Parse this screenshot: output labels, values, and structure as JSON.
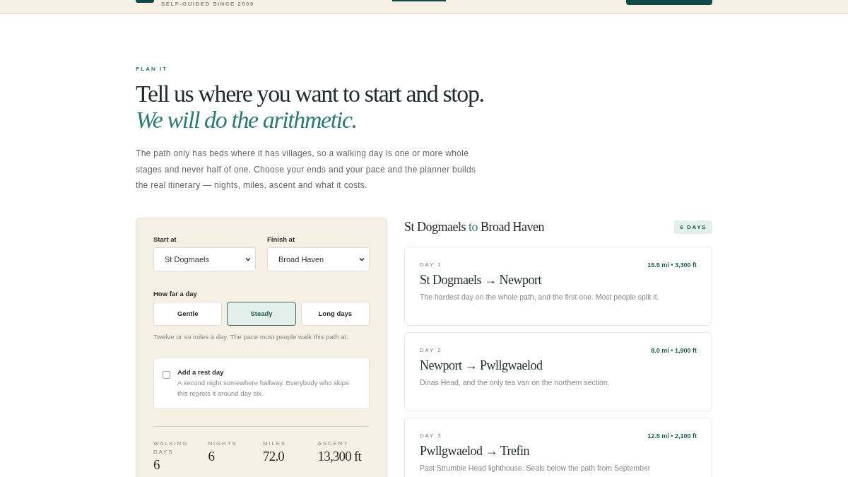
{
  "header": {
    "tagline": "SELF-GUIDED SINCE 2009"
  },
  "intro": {
    "eyebrow": "PLAN IT",
    "heading": "Tell us where you want to start and stop. *We will do the arithmetic.*",
    "body": "The path only has beds where it has villages, so a walking day is one or more whole stages and never half of one. Choose your ends and your pace and the planner builds the real itinerary — nights, miles, ascent and what it costs."
  },
  "planner": {
    "start": {
      "label": "Start at",
      "value": "St Dogmaels"
    },
    "finish": {
      "label": "Finish at",
      "value": "Broad Haven"
    },
    "pace": {
      "label": "How far a day",
      "options": [
        {
          "label": "Gentle",
          "selected": false
        },
        {
          "label": "Steady",
          "selected": true
        },
        {
          "label": "Long days",
          "selected": false
        }
      ],
      "note": "Twelve or so miles a day. The pace most people walk this path at."
    },
    "rest_day": {
      "title": "Add a rest day",
      "description": "A second night somewhere halfway. Everybody who skips this regrets it around day six.",
      "checked": false
    },
    "stats": [
      {
        "label": "WALKING DAYS",
        "value": "6"
      },
      {
        "label": "NIGHTS",
        "value": "6"
      },
      {
        "label": "MILES",
        "value": "72.0"
      },
      {
        "label": "ASCENT",
        "value": "13,300 ft"
      }
    ]
  },
  "itinerary": {
    "from": "St Dogmaels",
    "joiner": "to",
    "to": "Broad Haven",
    "badge": "6 DAYS",
    "days": [
      {
        "day": "DAY 1",
        "stats": "15.5 mi • 3,300 ft",
        "route": "St Dogmaels → Newport",
        "description": "The hardest day on the whole path, and the first one. Most people split it."
      },
      {
        "day": "DAY 2",
        "stats": "8.0 mi • 1,900 ft",
        "route": "Newport → Pwllgwaelod",
        "description": "Dinas Head, and the only tea van on the northern section."
      },
      {
        "day": "DAY 3",
        "stats": "12.5 mi • 2,100 ft",
        "route": "Pwllgwaelod → Trefin",
        "description": "Past Strumble Head lighthouse. Seals below the path from September"
      }
    ]
  }
}
